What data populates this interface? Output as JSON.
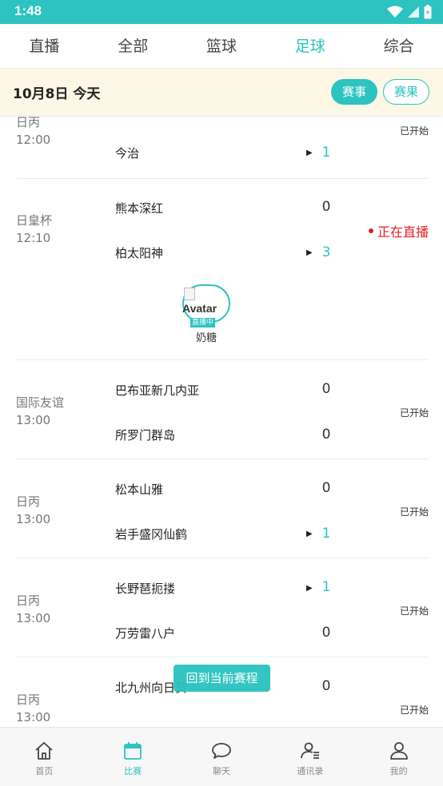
{
  "status_bar": {
    "time": "1:48"
  },
  "tabs": [
    {
      "label": "直播"
    },
    {
      "label": "全部"
    },
    {
      "label": "篮球"
    },
    {
      "label": "足球"
    },
    {
      "label": "综合"
    }
  ],
  "active_tab": "足球",
  "date_bar": {
    "date": "10月8日 今天",
    "events_label": "赛事",
    "results_label": "赛果"
  },
  "matches": [
    {
      "league": "日丙",
      "time": "12:00",
      "home": "",
      "away": "今治",
      "home_score": "",
      "away_score": "1",
      "status": "已开始"
    },
    {
      "league": "日皇杯",
      "time": "12:10",
      "home": "熊本深红",
      "away": "柏太阳神",
      "home_score": "0",
      "away_score": "3",
      "status": "正在直播",
      "streamer": {
        "alt": "Avatar",
        "badge": "直播中",
        "name": "奶糖"
      }
    },
    {
      "league": "国际友谊",
      "time": "13:00",
      "home": "巴布亚新几内亚",
      "away": "所罗门群岛",
      "home_score": "0",
      "away_score": "0",
      "status": "已开始"
    },
    {
      "league": "日丙",
      "time": "13:00",
      "home": "松本山雅",
      "away": "岩手盛冈仙鹤",
      "home_score": "0",
      "away_score": "1",
      "status": "已开始"
    },
    {
      "league": "日丙",
      "time": "13:00",
      "home": "长野琶扼搂",
      "away": "万劳雷八户",
      "home_score": "1",
      "away_score": "0",
      "status": "已开始"
    },
    {
      "league": "日丙",
      "time": "13:00",
      "home": "北九州向日葵",
      "away": "",
      "home_score": "0",
      "away_score": "",
      "status": "已开始"
    }
  ],
  "back_button": "回到当前赛程",
  "bottom_nav": [
    {
      "label": "首页",
      "icon": "home-icon"
    },
    {
      "label": "比赛",
      "icon": "calendar-icon"
    },
    {
      "label": "聊天",
      "icon": "chat-bubble-icon"
    },
    {
      "label": "通讯录",
      "icon": "contacts-icon"
    },
    {
      "label": "我的",
      "icon": "profile-icon"
    }
  ],
  "active_nav": "比赛",
  "colors": {
    "accent": "#2cc3c0",
    "live": "#e02020",
    "date_bar_bg": "#fdf7e6"
  }
}
